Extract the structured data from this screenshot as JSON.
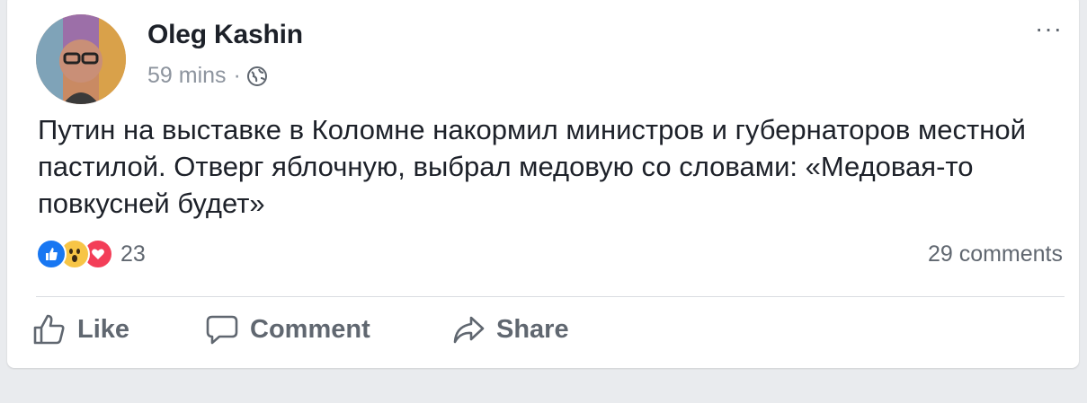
{
  "post": {
    "author": "Oleg Kashin",
    "timestamp": "59 mins",
    "separator": "·",
    "privacy_icon": "globe-icon",
    "more_label": "···",
    "text": "Путин на выставке в Коломне накормил министров и губернаторов местной пастилой. Отверг яблочную, выбрал медовую со словами: «Медовая-то повкусней будет»"
  },
  "stats": {
    "reactions": [
      "like-icon",
      "wow-icon",
      "love-icon"
    ],
    "reaction_count": "23",
    "comments": "29 comments"
  },
  "actions": {
    "like": "Like",
    "comment": "Comment",
    "share": "Share"
  },
  "colors": {
    "like_blue": "#1877f2",
    "wow_yellow": "#f7c546",
    "love_red": "#f33e58",
    "muted_text": "#606770",
    "meta_text": "#8d949e"
  }
}
